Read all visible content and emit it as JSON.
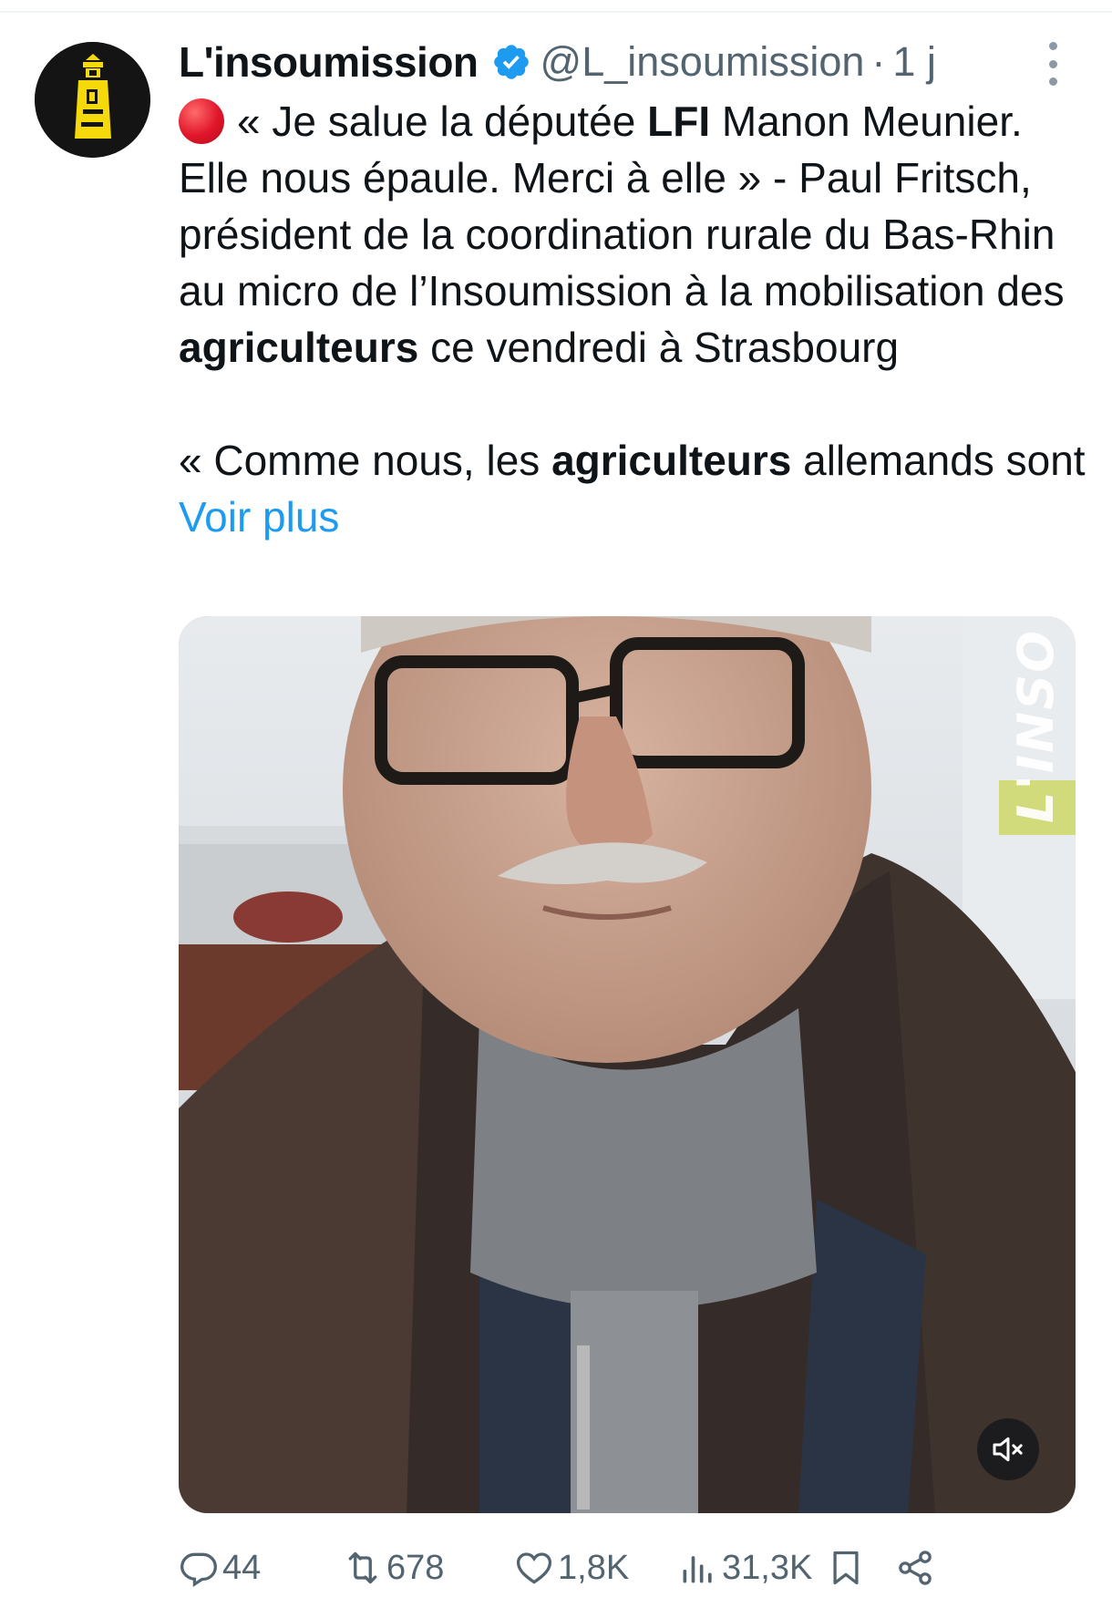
{
  "tweet": {
    "author": {
      "display_name": "L'insoumission",
      "handle": "@L_insoumission",
      "separator": "·",
      "time": "1 j",
      "verified_badge": "verified-icon",
      "avatar": "lighthouse-logo"
    },
    "text": {
      "emoji": "red-circle",
      "p1_a": "« Je salue la députée ",
      "p1_bold1": "LFI",
      "p1_b": " Manon Meunier. Elle nous épaule. Merci à elle » - Paul Fritsch, président de la coordination rurale du Bas-Rhin au micro de l’Insoumission à la mobilisation des ",
      "p1_bold2": "agriculteurs",
      "p1_c": " ce vendredi à Strasbourg",
      "p2_a": "« Comme nous, les ",
      "p2_bold": "agriculteurs",
      "p2_b": " allemands sont ",
      "see_more": "Voir plus"
    },
    "media": {
      "type": "video",
      "watermark": "L'INSO",
      "mute_icon": "muted-speaker-icon"
    },
    "actions": {
      "reply": "44",
      "retweet": "678",
      "like": "1,8K",
      "views": "31,3K"
    }
  },
  "colors": {
    "text": "#0f1419",
    "secondary": "#536471",
    "link": "#1d9bf0",
    "verified": "#1d9bf0"
  }
}
